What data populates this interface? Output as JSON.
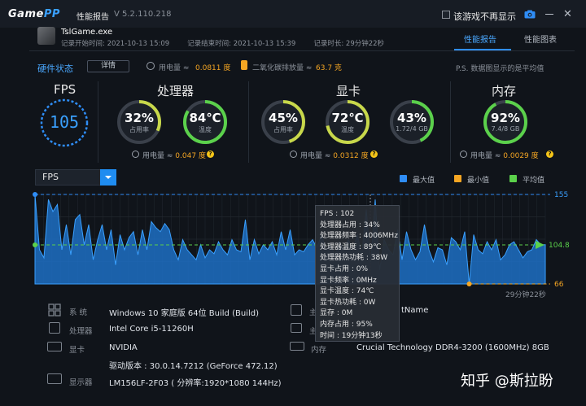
{
  "app": {
    "brand_prefix": "Game",
    "brand_suffix": "PP",
    "window_title": "性能报告",
    "version": "V 5.2.110.218",
    "dont_show_label": "该游戏不再显示"
  },
  "header": {
    "game_name": "TslGame.exe",
    "start_time": "记录开始时间: 2021-10-13 15:09",
    "end_time": "记录结束时间: 2021-10-13 15:39",
    "duration": "记录时长: 29分钟22秒",
    "tabs": [
      {
        "label": "性能报告",
        "active": true
      },
      {
        "label": "性能图表",
        "active": false
      }
    ]
  },
  "hardware": {
    "label": "硬件状态",
    "details_button": "详情",
    "power_label": "用电量 ≈",
    "power_value": "0.0811 度",
    "co2_label": "二氧化碳排放量 ≈",
    "co2_value": "63.7 克",
    "note": "P.S. 数据图显示的是平均值"
  },
  "metrics": {
    "fps": {
      "title": "FPS",
      "value": "105"
    },
    "cpu": {
      "title": "处理器",
      "usage": {
        "value": "32%",
        "label": "占用率",
        "fraction": 0.32,
        "color": "#c8d84a"
      },
      "temp": {
        "value": "84℃",
        "label": "温度",
        "fraction": 0.84,
        "color": "#5bd14b"
      },
      "power_label": "用电量 ≈",
      "power_value": "0.047 度"
    },
    "gpu": {
      "title": "显卡",
      "usage": {
        "value": "45%",
        "label": "占用率",
        "fraction": 0.45,
        "color": "#c8d84a"
      },
      "temp": {
        "value": "72℃",
        "label": "温度",
        "fraction": 0.72,
        "color": "#c8d84a"
      },
      "vram": {
        "value": "43%",
        "label": "1.72/4 GB",
        "fraction": 0.43,
        "color": "#5bd14b"
      },
      "power_label": "用电量 ≈",
      "power_value": "0.0312 度"
    },
    "memory": {
      "title": "内存",
      "usage": {
        "value": "92%",
        "label": "7.4/8 GB",
        "fraction": 0.92,
        "color": "#5bd14b"
      },
      "power_label": "用电量 ≈",
      "power_value": "0.0029 度"
    }
  },
  "chart_controls": {
    "selected_metric": "FPS",
    "legend": [
      {
        "label": "最大值",
        "color": "#2f8df5"
      },
      {
        "label": "最小值",
        "color": "#f5a623"
      },
      {
        "label": "平均值",
        "color": "#5bd14b"
      }
    ],
    "duration_label": "29分钟22秒"
  },
  "chart_data": {
    "type": "area",
    "title": "",
    "xlabel": "",
    "ylabel": "",
    "x_end_label": "29分钟22秒",
    "ylim": [
      66,
      155
    ],
    "max": 155,
    "avg": 104.8,
    "min": 66,
    "max_label": "155",
    "avg_label": "104.8",
    "min_label": "66",
    "series": [
      {
        "values": [
          155,
          100,
          92,
          150,
          138,
          145,
          100,
          125,
          95,
          130,
          135,
          105,
          125,
          90,
          110,
          125,
          100,
          120,
          85,
          115,
          100,
          112,
          118,
          95,
          120,
          100,
          128,
          122,
          118,
          126,
          120,
          100,
          90,
          110,
          100,
          95,
          90,
          105,
          92,
          100,
          96,
          108,
          100,
          95,
          110,
          100,
          98,
          130,
          90,
          110,
          96,
          105,
          100,
          108,
          95,
          118,
          100,
          120,
          95,
          100,
          98,
          105,
          110,
          102,
          115,
          100,
          105,
          95,
          108,
          100,
          110,
          100,
          115,
          95,
          140,
          88,
          150,
          80,
          110,
          100,
          95,
          120,
          90,
          118,
          100,
          90,
          98,
          125,
          100,
          88,
          102,
          100,
          85,
          112,
          108,
          100,
          118,
          66,
          115,
          100,
          96,
          108,
          100,
          110,
          90,
          95,
          105,
          108,
          100,
          92,
          98,
          100,
          110,
          105,
          105
        ]
      }
    ]
  },
  "tooltip": [
    "FPS : 102",
    "处理器占用 : 34%",
    "处理器频率 : 4006MHz",
    "处理器温度 : 89℃",
    "处理器热功耗 : 38W",
    "显卡占用 : 0%",
    "显卡频率 : 0MHz",
    "显卡温度 : 74℃",
    "显卡热功耗 : 0W",
    "显存 : 0M",
    "内存占用 : 95%",
    "时间 : 19分钟13秒"
  ],
  "system": {
    "os": {
      "key": "系 统",
      "value": "Windows 10 家庭版 64位  Build (Build)"
    },
    "os_extra": "tName",
    "cpu": {
      "key": "处理器",
      "value": "Intel Core i5-11260H"
    },
    "gpu": {
      "key": "显卡",
      "value": "NVIDIA"
    },
    "driver": "驱动版本 : 30.0.14.7212 (GeForce 472.12)",
    "display": {
      "key": "显示器",
      "value": "LM156LF-2F03 ( 分辨率:1920*1080 144Hz)"
    },
    "memory": {
      "key": "内存",
      "value": "Crucial Technology DDR4-3200 (1600MHz) 8GB"
    },
    "mb_key_partial": "主",
    "disk_key_partial": "主"
  },
  "watermark": "知乎 @斯拉盼"
}
